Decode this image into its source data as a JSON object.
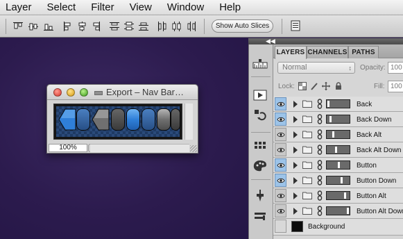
{
  "menu": {
    "items": [
      "Layer",
      "Select",
      "Filter",
      "View",
      "Window",
      "Help"
    ]
  },
  "options_bar": {
    "auto_slices_label": "Show Auto Slices"
  },
  "export_window": {
    "title": "Export – Nav Bar…",
    "zoom": "100%"
  },
  "panel": {
    "tabs": [
      "LAYERS",
      "CHANNELS",
      "PATHS"
    ],
    "active_tab": "LAYERS",
    "blend_mode": "Normal",
    "opacity_label": "Opacity:",
    "opacity_value": "100",
    "lock_label": "Lock:",
    "fill_label": "Fill:",
    "fill_value": "100",
    "layers": [
      {
        "name": "Back",
        "visible": true,
        "highlighted": true
      },
      {
        "name": "Back Down",
        "visible": true,
        "highlighted": true
      },
      {
        "name": "Back Alt",
        "visible": true,
        "highlighted": false
      },
      {
        "name": "Back Alt Down",
        "visible": true,
        "highlighted": false
      },
      {
        "name": "Button",
        "visible": true,
        "highlighted": true
      },
      {
        "name": "Button Down",
        "visible": true,
        "highlighted": true
      },
      {
        "name": "Button Alt",
        "visible": true,
        "highlighted": false
      },
      {
        "name": "Button Alt Down",
        "visible": true,
        "highlighted": false
      }
    ],
    "background_layer": "Background"
  },
  "colors": {
    "canvas": "#2c1b4e",
    "eye_highlight": "#9cc3e8",
    "nav_blue": "#2f7fd8",
    "nav_gray": "#707070"
  }
}
